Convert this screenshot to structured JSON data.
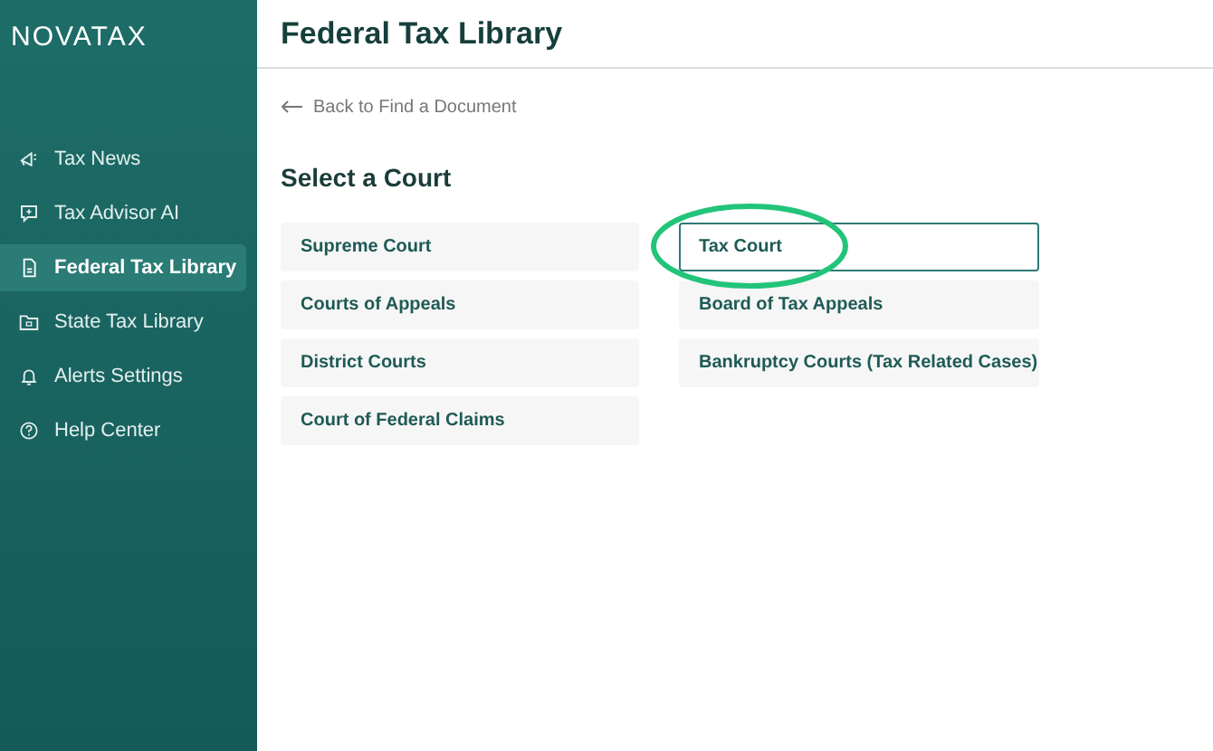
{
  "logo": "NOVATAX",
  "sidebar": {
    "items": [
      {
        "label": "Tax News",
        "selected": false
      },
      {
        "label": "Tax Advisor AI",
        "selected": false
      },
      {
        "label": "Federal Tax Library",
        "selected": true
      },
      {
        "label": "State Tax Library",
        "selected": false
      },
      {
        "label": "Alerts Settings",
        "selected": false
      },
      {
        "label": "Help Center",
        "selected": false
      }
    ]
  },
  "header": {
    "title": "Federal Tax Library"
  },
  "back_link": "Back to Find a Document",
  "heading": "Select a Court",
  "courts": {
    "columns": [
      [
        {
          "label": "Supreme Court",
          "selected": false
        },
        {
          "label": "Courts of Appeals",
          "selected": false
        },
        {
          "label": "District Courts",
          "selected": false
        },
        {
          "label": "Court of Federal Claims",
          "selected": false
        }
      ],
      [
        {
          "label": "Tax Court",
          "selected": true,
          "circled": true
        },
        {
          "label": "Board of Tax Appeals",
          "selected": false
        },
        {
          "label": "Bankruptcy Courts (Tax Related Cases)",
          "selected": false
        }
      ]
    ]
  }
}
